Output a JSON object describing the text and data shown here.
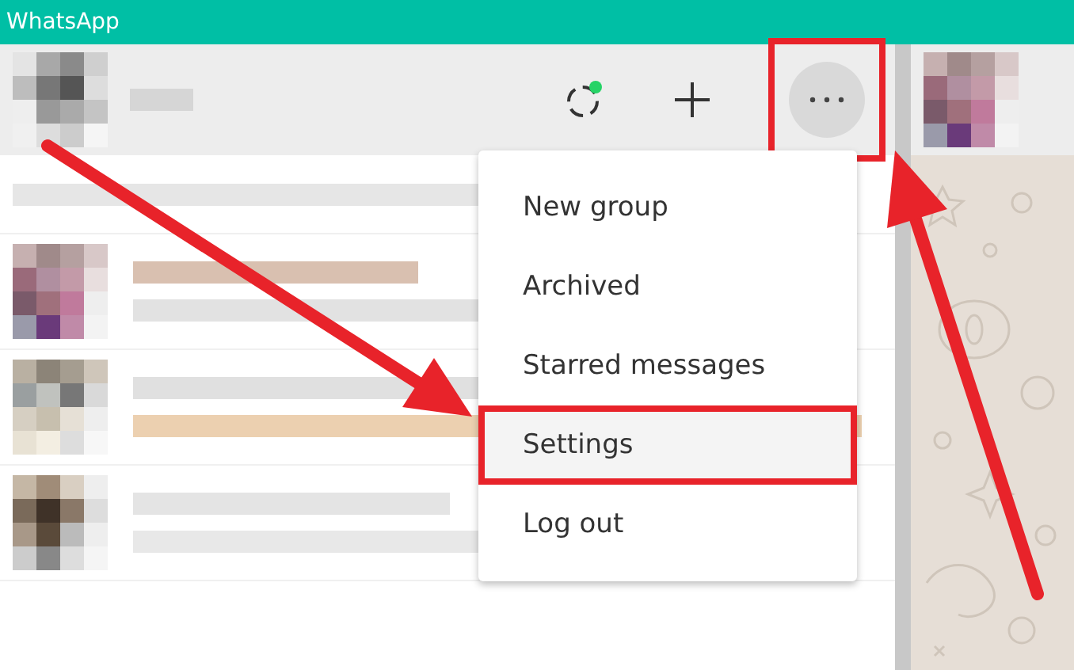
{
  "window": {
    "title": "WhatsApp"
  },
  "header": {
    "menu_button_highlighted": true
  },
  "menu": {
    "items": [
      {
        "label": "New group",
        "selected": false
      },
      {
        "label": "Archived",
        "selected": false
      },
      {
        "label": "Starred messages",
        "selected": false
      },
      {
        "label": "Settings",
        "selected": true
      },
      {
        "label": "Log out",
        "selected": false
      }
    ]
  },
  "annotations": [
    {
      "kind": "arrow"
    },
    {
      "kind": "arrow"
    }
  ]
}
